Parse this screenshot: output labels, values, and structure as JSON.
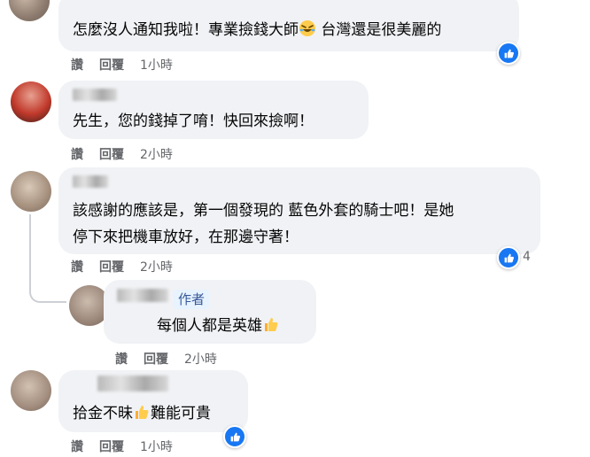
{
  "comments": [
    {
      "text": "怎麼沒人通知我啦！專業撿錢大師🤣 台灣還是很美麗的",
      "text_before": "怎麼沒人通知我啦！專業撿錢大師",
      "emoji": "rofl-emoji",
      "text_after": " 台灣還是很美麗的",
      "actions": [
        "讚",
        "回覆"
      ],
      "time": "1小時",
      "reaction": "like-icon"
    },
    {
      "text": "先生，您的錢掉了唷！快回來撿啊！",
      "actions": [
        "讚",
        "回覆"
      ],
      "time": "2小時"
    },
    {
      "text_line1": "該感謝的應該是，第一個發現的 藍色外套的騎士吧！是她",
      "text_line2": "停下來把機車放好，在那邊守著！",
      "actions": [
        "讚",
        "回覆"
      ],
      "time": "2小時",
      "reaction": "like-icon",
      "reaction_count": "4",
      "reply": {
        "badge": "作者",
        "text": "每個人都是英雄",
        "emoji": "thumbs-up-emoji",
        "actions": [
          "讚",
          "回覆"
        ],
        "time": "2小時"
      }
    },
    {
      "text_before": "拾金不昧",
      "emoji": "thumbs-up-emoji",
      "text_after": "難能可貴",
      "actions": [
        "讚",
        "回覆"
      ],
      "time": "1小時",
      "reaction": "like-icon"
    }
  ],
  "colors": {
    "bubble": "#f0f2f5",
    "like_blue": "#1877f2",
    "meta": "#65676b"
  }
}
